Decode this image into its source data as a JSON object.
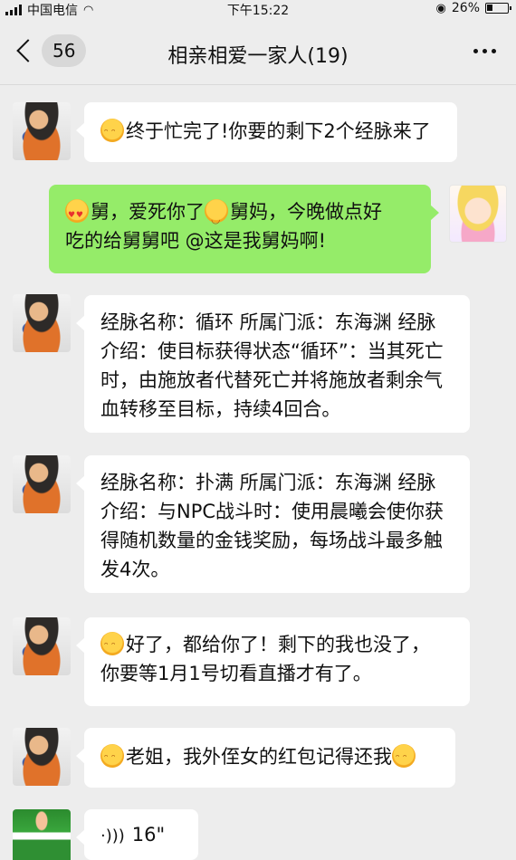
{
  "status_bar": {
    "carrier": "中国电信",
    "time": "下午15:22",
    "battery": "26%"
  },
  "header": {
    "unread_count": "56",
    "title": "相亲相爱一家人(19)"
  },
  "messages": [
    {
      "sender": "other",
      "avatar": "goku-avatar",
      "text": "终于忙完了!你要的剩下2个经脉来了"
    },
    {
      "sender": "self",
      "avatar": "sailor-avatar",
      "text_part1": "舅，爱死你了",
      "text_part2": "舅妈，今晚做点好",
      "text_line2": "吃的给舅舅吧 @这是我舅妈啊!"
    },
    {
      "sender": "other",
      "avatar": "goku-avatar",
      "lines": [
        "经脉名称：循环 所属门派：东海渊 经脉",
        "介绍：使目标获得状态“循环”：当其死亡",
        "时，由施放者代替死亡并将施放者剩余气",
        "血转移至目标，持续4回合。"
      ]
    },
    {
      "sender": "other",
      "avatar": "goku-avatar",
      "lines": [
        "经脉名称：扑满 所属门派：东海渊 经脉",
        "介绍：与NPC战斗时：使用晨曦会使你获",
        "得随机数量的金钱奖励，每场战斗最多触",
        "发4次。"
      ]
    },
    {
      "sender": "other",
      "avatar": "goku-avatar",
      "line1": "好了，都给你了！剩下的我也没了，",
      "line2": "你要等1月1号切看直播才有了。"
    },
    {
      "sender": "other",
      "avatar": "goku-avatar",
      "text": "老姐，我外侄女的红包记得还我"
    },
    {
      "sender": "other",
      "avatar": "green-avatar",
      "voice_duration": "16\""
    }
  ]
}
